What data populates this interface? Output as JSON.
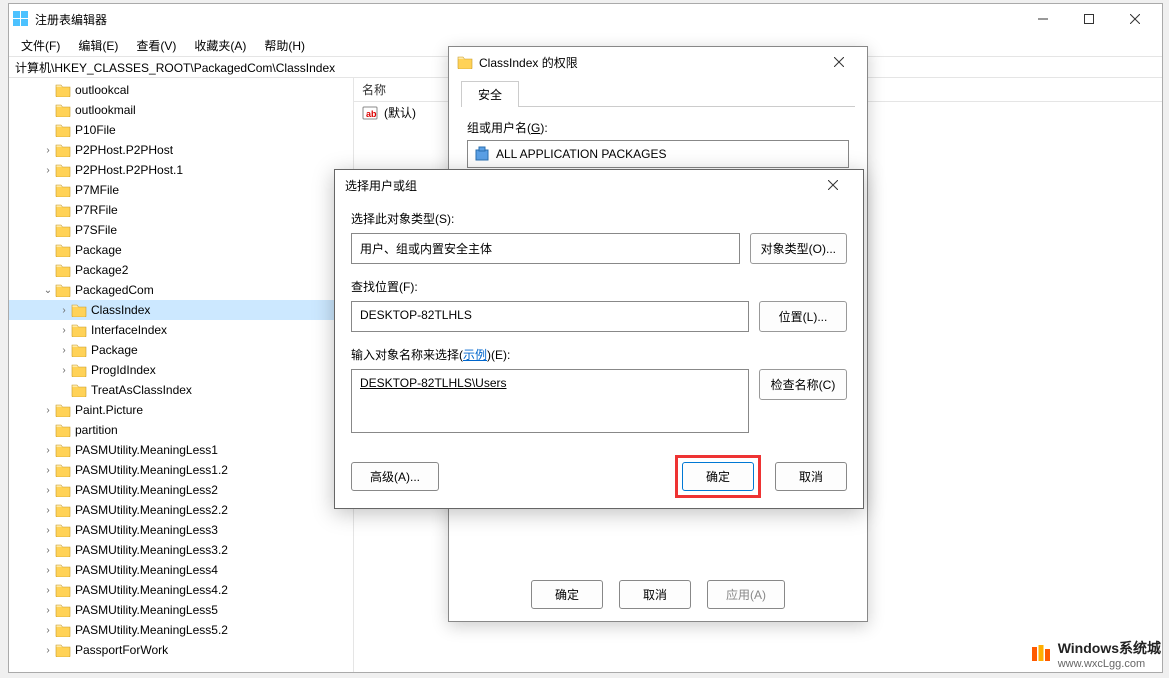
{
  "app_title": "注册表编辑器",
  "menu": {
    "file": "文件(F)",
    "edit": "编辑(E)",
    "view": "查看(V)",
    "favorites": "收藏夹(A)",
    "help": "帮助(H)"
  },
  "address": "计算机\\HKEY_CLASSES_ROOT\\PackagedCom\\ClassIndex",
  "values_header": {
    "name": "名称"
  },
  "default_value": "(默认)",
  "tree": [
    {
      "indent": 2,
      "exp": "none",
      "label": "outlookcal"
    },
    {
      "indent": 2,
      "exp": "none",
      "label": "outlookmail"
    },
    {
      "indent": 2,
      "exp": "none",
      "label": "P10File"
    },
    {
      "indent": 2,
      "exp": "closed",
      "label": "P2PHost.P2PHost"
    },
    {
      "indent": 2,
      "exp": "closed",
      "label": "P2PHost.P2PHost.1"
    },
    {
      "indent": 2,
      "exp": "none",
      "label": "P7MFile"
    },
    {
      "indent": 2,
      "exp": "none",
      "label": "P7RFile"
    },
    {
      "indent": 2,
      "exp": "none",
      "label": "P7SFile"
    },
    {
      "indent": 2,
      "exp": "none",
      "label": "Package"
    },
    {
      "indent": 2,
      "exp": "none",
      "label": "Package2"
    },
    {
      "indent": 2,
      "exp": "open",
      "label": "PackagedCom"
    },
    {
      "indent": 3,
      "exp": "closed",
      "label": "ClassIndex",
      "selected": true
    },
    {
      "indent": 3,
      "exp": "closed",
      "label": "InterfaceIndex"
    },
    {
      "indent": 3,
      "exp": "closed",
      "label": "Package"
    },
    {
      "indent": 3,
      "exp": "closed",
      "label": "ProgIdIndex"
    },
    {
      "indent": 3,
      "exp": "none",
      "label": "TreatAsClassIndex"
    },
    {
      "indent": 2,
      "exp": "closed",
      "label": "Paint.Picture"
    },
    {
      "indent": 2,
      "exp": "none",
      "label": "partition"
    },
    {
      "indent": 2,
      "exp": "closed",
      "label": "PASMUtility.MeaningLess1"
    },
    {
      "indent": 2,
      "exp": "closed",
      "label": "PASMUtility.MeaningLess1.2"
    },
    {
      "indent": 2,
      "exp": "closed",
      "label": "PASMUtility.MeaningLess2"
    },
    {
      "indent": 2,
      "exp": "closed",
      "label": "PASMUtility.MeaningLess2.2"
    },
    {
      "indent": 2,
      "exp": "closed",
      "label": "PASMUtility.MeaningLess3"
    },
    {
      "indent": 2,
      "exp": "closed",
      "label": "PASMUtility.MeaningLess3.2"
    },
    {
      "indent": 2,
      "exp": "closed",
      "label": "PASMUtility.MeaningLess4"
    },
    {
      "indent": 2,
      "exp": "closed",
      "label": "PASMUtility.MeaningLess4.2"
    },
    {
      "indent": 2,
      "exp": "closed",
      "label": "PASMUtility.MeaningLess5"
    },
    {
      "indent": 2,
      "exp": "closed",
      "label": "PASMUtility.MeaningLess5.2"
    },
    {
      "indent": 2,
      "exp": "closed",
      "label": "PassportForWork"
    }
  ],
  "perm_dialog": {
    "title": "ClassIndex 的权限",
    "tab_security": "安全",
    "group_label_pre": "组或用户名(",
    "group_label_u": "G",
    "group_label_post": "):",
    "entry": "ALL APPLICATION PACKAGES",
    "ok": "确定",
    "cancel": "取消",
    "apply": "应用(A)"
  },
  "select_dialog": {
    "title": "选择用户或组",
    "object_type_label": "选择此对象类型(S):",
    "object_type_value": "用户、组或内置安全主体",
    "object_type_btn": "对象类型(O)...",
    "location_label": "查找位置(F):",
    "location_value": "DESKTOP-82TLHLS",
    "location_btn": "位置(L)...",
    "name_label_pre": "输入对象名称来选择(",
    "name_label_link": "示例",
    "name_label_post": ")(E):",
    "name_value": "DESKTOP-82TLHLS\\Users",
    "check_btn": "检查名称(C)",
    "advanced_btn": "高级(A)...",
    "ok": "确定",
    "cancel": "取消"
  },
  "watermark": {
    "brand": "Windows系统城",
    "url": "www.wxcLgg.com"
  }
}
